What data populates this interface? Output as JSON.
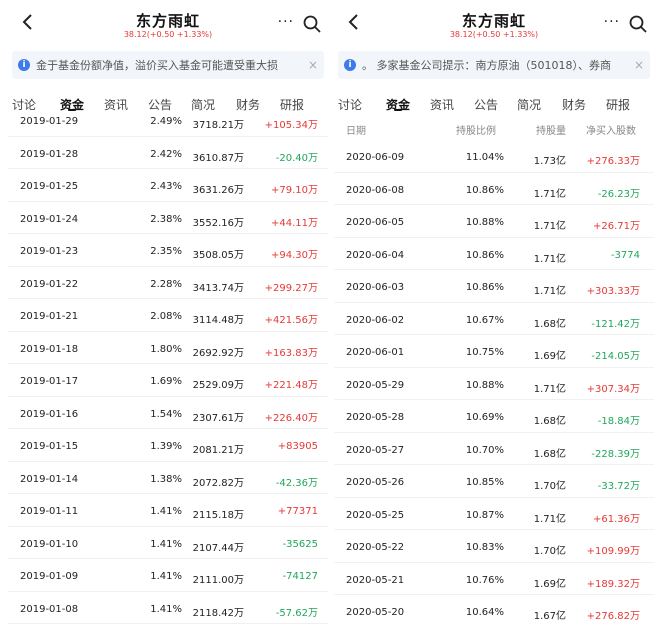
{
  "colors": {
    "up": "#e53935",
    "down": "#21a65b",
    "accent": "#3d7be8"
  },
  "left": {
    "header": {
      "title": "东方雨虹",
      "quote": "38.12(+0.50 +1.33%)",
      "more": "···"
    },
    "notice": {
      "text": "金于基金份额净值，溢价买入基金可能遭受重大损",
      "close": "×"
    },
    "tabs": [
      "讨论",
      "资金",
      "资讯",
      "公告",
      "简况",
      "财务",
      "研报"
    ],
    "active_tab": 1,
    "rows": [
      {
        "date": "2019-01-29",
        "ratio": "2.49%",
        "shares": "3718.21万",
        "flow": "+105.34万",
        "dir": "up"
      },
      {
        "date": "2019-01-28",
        "ratio": "2.42%",
        "shares": "3610.87万",
        "flow": "-20.40万",
        "dir": "down"
      },
      {
        "date": "2019-01-25",
        "ratio": "2.43%",
        "shares": "3631.26万",
        "flow": "+79.10万",
        "dir": "up"
      },
      {
        "date": "2019-01-24",
        "ratio": "2.38%",
        "shares": "3552.16万",
        "flow": "+44.11万",
        "dir": "up"
      },
      {
        "date": "2019-01-23",
        "ratio": "2.35%",
        "shares": "3508.05万",
        "flow": "+94.30万",
        "dir": "up"
      },
      {
        "date": "2019-01-22",
        "ratio": "2.28%",
        "shares": "3413.74万",
        "flow": "+299.27万",
        "dir": "up"
      },
      {
        "date": "2019-01-21",
        "ratio": "2.08%",
        "shares": "3114.48万",
        "flow": "+421.56万",
        "dir": "up"
      },
      {
        "date": "2019-01-18",
        "ratio": "1.80%",
        "shares": "2692.92万",
        "flow": "+163.83万",
        "dir": "up"
      },
      {
        "date": "2019-01-17",
        "ratio": "1.69%",
        "shares": "2529.09万",
        "flow": "+221.48万",
        "dir": "up"
      },
      {
        "date": "2019-01-16",
        "ratio": "1.54%",
        "shares": "2307.61万",
        "flow": "+226.40万",
        "dir": "up"
      },
      {
        "date": "2019-01-15",
        "ratio": "1.39%",
        "shares": "2081.21万",
        "flow": "+83905",
        "dir": "up"
      },
      {
        "date": "2019-01-14",
        "ratio": "1.38%",
        "shares": "2072.82万",
        "flow": "-42.36万",
        "dir": "down"
      },
      {
        "date": "2019-01-11",
        "ratio": "1.41%",
        "shares": "2115.18万",
        "flow": "+77371",
        "dir": "up"
      },
      {
        "date": "2019-01-10",
        "ratio": "1.41%",
        "shares": "2107.44万",
        "flow": "-35625",
        "dir": "down"
      },
      {
        "date": "2019-01-09",
        "ratio": "1.41%",
        "shares": "2111.00万",
        "flow": "-74127",
        "dir": "down"
      },
      {
        "date": "2019-01-08",
        "ratio": "1.41%",
        "shares": "2118.42万",
        "flow": "-57.62万",
        "dir": "down"
      }
    ]
  },
  "right": {
    "header": {
      "title": "东方雨虹",
      "quote": "38.12(+0.50 +1.33%)",
      "more": "···"
    },
    "notice": {
      "text": "。  多家基金公司提示：南方原油（501018）、券商",
      "close": "×"
    },
    "tabs": [
      "讨论",
      "资金",
      "资讯",
      "公告",
      "简况",
      "财务",
      "研报"
    ],
    "active_tab": 1,
    "columns": [
      "日期",
      "持股比例",
      "持股量",
      "净买入股数"
    ],
    "rows": [
      {
        "date": "2020-06-09",
        "ratio": "11.04%",
        "shares": "1.73亿",
        "flow": "+276.33万",
        "dir": "up"
      },
      {
        "date": "2020-06-08",
        "ratio": "10.86%",
        "shares": "1.71亿",
        "flow": "-26.23万",
        "dir": "down"
      },
      {
        "date": "2020-06-05",
        "ratio": "10.88%",
        "shares": "1.71亿",
        "flow": "+26.71万",
        "dir": "up"
      },
      {
        "date": "2020-06-04",
        "ratio": "10.86%",
        "shares": "1.71亿",
        "flow": "-3774",
        "dir": "down"
      },
      {
        "date": "2020-06-03",
        "ratio": "10.86%",
        "shares": "1.71亿",
        "flow": "+303.33万",
        "dir": "up"
      },
      {
        "date": "2020-06-02",
        "ratio": "10.67%",
        "shares": "1.68亿",
        "flow": "-121.42万",
        "dir": "down"
      },
      {
        "date": "2020-06-01",
        "ratio": "10.75%",
        "shares": "1.69亿",
        "flow": "-214.05万",
        "dir": "down"
      },
      {
        "date": "2020-05-29",
        "ratio": "10.88%",
        "shares": "1.71亿",
        "flow": "+307.34万",
        "dir": "up"
      },
      {
        "date": "2020-05-28",
        "ratio": "10.69%",
        "shares": "1.68亿",
        "flow": "-18.84万",
        "dir": "down"
      },
      {
        "date": "2020-05-27",
        "ratio": "10.70%",
        "shares": "1.68亿",
        "flow": "-228.39万",
        "dir": "down"
      },
      {
        "date": "2020-05-26",
        "ratio": "10.85%",
        "shares": "1.70亿",
        "flow": "-33.72万",
        "dir": "down"
      },
      {
        "date": "2020-05-25",
        "ratio": "10.87%",
        "shares": "1.71亿",
        "flow": "+61.36万",
        "dir": "up"
      },
      {
        "date": "2020-05-22",
        "ratio": "10.83%",
        "shares": "1.70亿",
        "flow": "+109.99万",
        "dir": "up"
      },
      {
        "date": "2020-05-21",
        "ratio": "10.76%",
        "shares": "1.69亿",
        "flow": "+189.32万",
        "dir": "up"
      },
      {
        "date": "2020-05-20",
        "ratio": "10.64%",
        "shares": "1.67亿",
        "flow": "+276.82万",
        "dir": "up"
      }
    ]
  }
}
